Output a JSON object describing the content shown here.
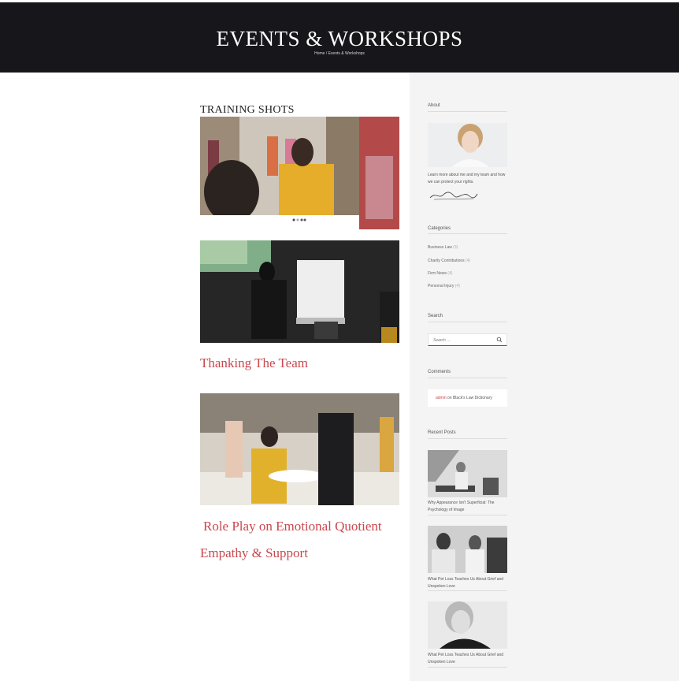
{
  "header": {
    "title": "EVENTS & WORKSHOPS",
    "breadcrumb": {
      "home": "Home",
      "separator": "/",
      "current": "Events & Workshops"
    }
  },
  "main": {
    "section_heading": "TRAINING SHOTS",
    "posts": [
      {
        "title": "Thanking The Team"
      },
      {
        "title": "Role Play on Emotional Quotient"
      },
      {
        "title": "Empathy & Support"
      }
    ]
  },
  "sidebar": {
    "about": {
      "title": "About",
      "text": "Learn more about me and my team and how we can protect your rights."
    },
    "categories": {
      "title": "Categories",
      "items": [
        {
          "label": "Business Law",
          "count": "(3)"
        },
        {
          "label": "Charity Contributions",
          "count": "(4)"
        },
        {
          "label": "Firm News",
          "count": "(4)"
        },
        {
          "label": "Personal Injury",
          "count": "(4)"
        }
      ]
    },
    "search": {
      "title": "Search",
      "placeholder": "Search ..."
    },
    "comments": {
      "title": "Comments",
      "author": "admin",
      "connector": "on",
      "post": "Black's Law Dictionary"
    },
    "recent_posts": {
      "title": "Recent Posts",
      "items": [
        {
          "caption": "Why Appearance Isn't Superficial: The Psychology of Image"
        },
        {
          "caption": "What Pet Loss Teaches Us About Grief and Unspoken Love"
        },
        {
          "caption": "What Pet Loss Teaches Us About Grief and Unspoken Love"
        }
      ]
    }
  },
  "colors": {
    "header_bg": "#17161b",
    "accent": "#c9474d",
    "sidebar_bg": "#f4f4f4"
  }
}
